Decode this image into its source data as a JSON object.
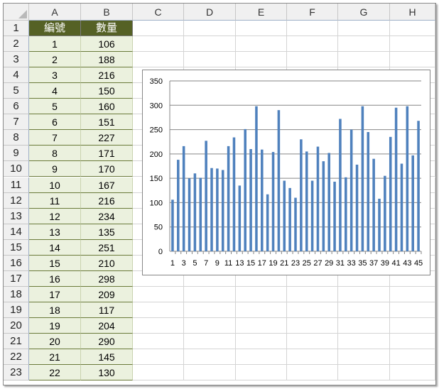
{
  "columns": [
    "A",
    "B",
    "C",
    "D",
    "E",
    "F",
    "G",
    "H"
  ],
  "rows": [
    "1",
    "2",
    "3",
    "4",
    "5",
    "6",
    "7",
    "8",
    "9",
    "10",
    "11",
    "12",
    "13",
    "14",
    "15",
    "16",
    "17",
    "18",
    "19",
    "20",
    "21",
    "22",
    "23"
  ],
  "table": {
    "headers": [
      "編號",
      "數量"
    ],
    "records": [
      [
        "1",
        "106"
      ],
      [
        "2",
        "188"
      ],
      [
        "3",
        "216"
      ],
      [
        "4",
        "150"
      ],
      [
        "5",
        "160"
      ],
      [
        "6",
        "151"
      ],
      [
        "7",
        "227"
      ],
      [
        "8",
        "171"
      ],
      [
        "9",
        "170"
      ],
      [
        "10",
        "167"
      ],
      [
        "11",
        "216"
      ],
      [
        "12",
        "234"
      ],
      [
        "13",
        "135"
      ],
      [
        "14",
        "251"
      ],
      [
        "15",
        "210"
      ],
      [
        "16",
        "298"
      ],
      [
        "17",
        "209"
      ],
      [
        "18",
        "117"
      ],
      [
        "19",
        "204"
      ],
      [
        "20",
        "290"
      ],
      [
        "21",
        "145"
      ],
      [
        "22",
        "130"
      ]
    ]
  },
  "chart_data": {
    "type": "bar",
    "title": "",
    "xlabel": "",
    "ylabel": "",
    "ylim": [
      0,
      350
    ],
    "yticks": [
      0,
      50,
      100,
      150,
      200,
      250,
      300,
      350
    ],
    "grid": true,
    "legend": "none",
    "bar_color": "#4f81bd",
    "categories": [
      "1",
      "2",
      "3",
      "4",
      "5",
      "6",
      "7",
      "8",
      "9",
      "10",
      "11",
      "12",
      "13",
      "14",
      "15",
      "16",
      "17",
      "18",
      "19",
      "20",
      "21",
      "22",
      "23",
      "24",
      "25",
      "26",
      "27",
      "28",
      "29",
      "30",
      "31",
      "32",
      "33",
      "34",
      "35",
      "36",
      "37",
      "38",
      "39",
      "40",
      "41",
      "42",
      "43",
      "44",
      "45"
    ],
    "xtick_labels": [
      "1",
      "3",
      "5",
      "7",
      "9",
      "11",
      "13",
      "15",
      "17",
      "19",
      "21",
      "23",
      "25",
      "27",
      "29",
      "31",
      "33",
      "35",
      "37",
      "39",
      "41",
      "43",
      "45"
    ],
    "values": [
      106,
      188,
      216,
      150,
      160,
      151,
      227,
      171,
      170,
      167,
      216,
      234,
      135,
      251,
      210,
      298,
      209,
      117,
      204,
      290,
      145,
      130,
      110,
      230,
      205,
      145,
      215,
      185,
      202,
      143,
      272,
      152,
      250,
      178,
      298,
      245,
      190,
      108,
      155,
      235,
      295,
      180,
      298,
      197,
      268
    ]
  }
}
